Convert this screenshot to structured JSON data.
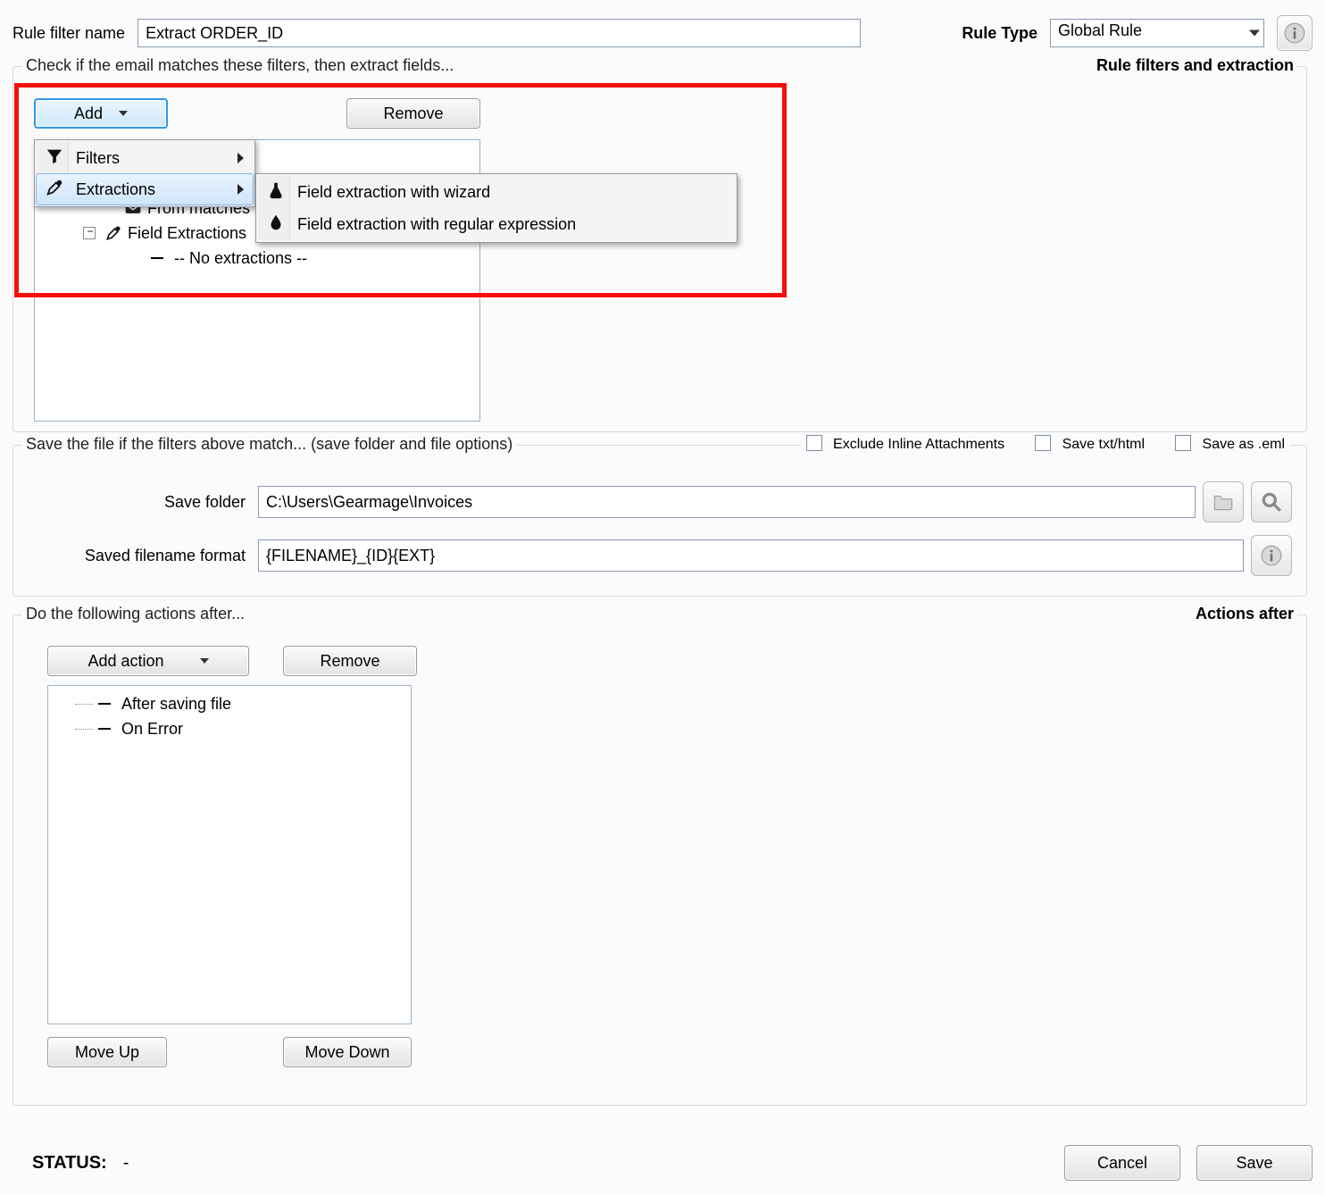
{
  "header": {
    "name_label": "Rule filter name",
    "name_value": "Extract ORDER_ID",
    "rule_type_label": "Rule Type",
    "rule_type_value": "Global Rule"
  },
  "group1": {
    "legend_left": "Check if the email matches these filters, then extract fields...",
    "legend_right": "Rule filters and extraction",
    "add_label": "Add",
    "remove_label": "Remove",
    "tree": {
      "from_matches": "From matches",
      "field_extractions": "Field Extractions",
      "no_extractions": "-- No extractions --"
    },
    "menu": {
      "filters": "Filters",
      "extractions": "Extractions",
      "sub": {
        "wizard": "Field extraction with wizard",
        "regex": "Field extraction with regular expression"
      }
    }
  },
  "group2": {
    "legend_left": "Save the file if the filters above match... (save folder and file options)",
    "chk_exclude": "Exclude Inline Attachments",
    "chk_txt": "Save txt/html",
    "chk_eml": "Save as .eml",
    "save_folder_label": "Save folder",
    "save_folder_value": "C:\\Users\\Gearmage\\Invoices",
    "filename_label": "Saved filename format",
    "filename_value": "{FILENAME}_{ID}{EXT}"
  },
  "group3": {
    "legend_left": "Do the following actions after...",
    "legend_right": "Actions after",
    "add_action": "Add action",
    "remove": "Remove",
    "after_saving": "After saving file",
    "on_error": "On Error",
    "move_up": "Move Up",
    "move_down": "Move Down"
  },
  "footer": {
    "status_label": "STATUS:",
    "status_value": "-",
    "cancel": "Cancel",
    "save": "Save"
  }
}
